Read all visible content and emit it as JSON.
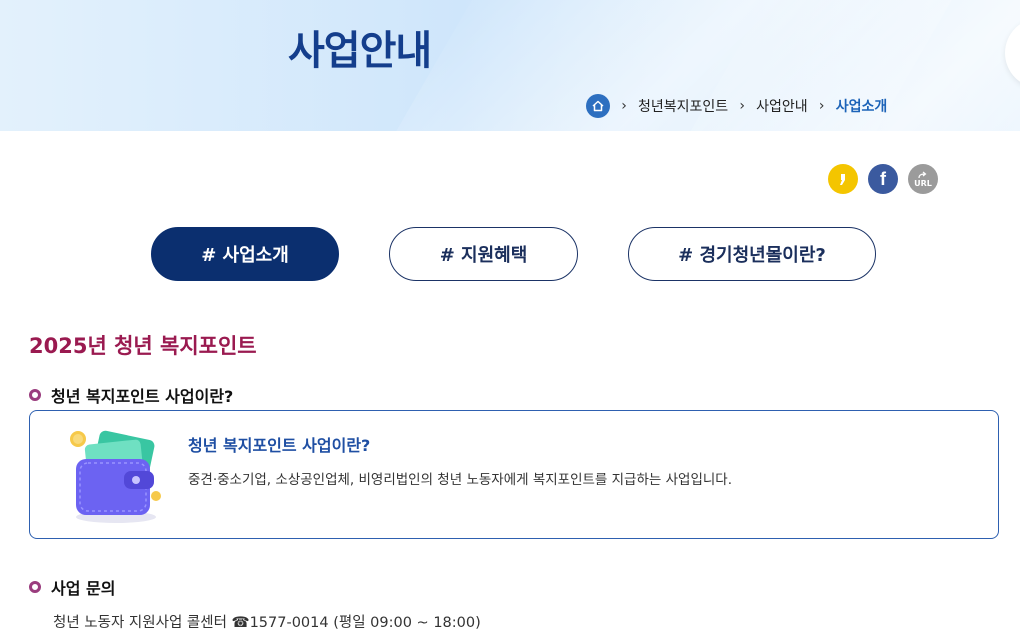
{
  "banner": {
    "title": "사업안내",
    "breadcrumb": [
      "청년복지포인트",
      "사업안내",
      "사업소개"
    ]
  },
  "share": {
    "kakao_icon": "kakao-icon",
    "facebook_label": "f",
    "url_label": "URL"
  },
  "tabs": [
    {
      "label": "# 사업소개",
      "active": true
    },
    {
      "label": "# 지원혜택",
      "active": false
    },
    {
      "label": "# 경기청년몰이란?",
      "active": false
    }
  ],
  "content": {
    "section_title": "2025년 청년 복지포인트",
    "subhead1": "청년 복지포인트 사업이란?",
    "box": {
      "title": "청년 복지포인트 사업이란?",
      "text": "중견·중소기업, 소상공인업체, 비영리법인의 청년 노동자에게 복지포인트를 지급하는 사업입니다."
    },
    "subhead2": "사업 문의",
    "contact": "청년 노동자 지원사업 콜센터 ☎1577-0014 (평일 09:00 ~ 18:00)"
  },
  "colors": {
    "navy": "#0b2f6f",
    "accent_title": "#9a1a50",
    "link_blue": "#1c63b8"
  }
}
